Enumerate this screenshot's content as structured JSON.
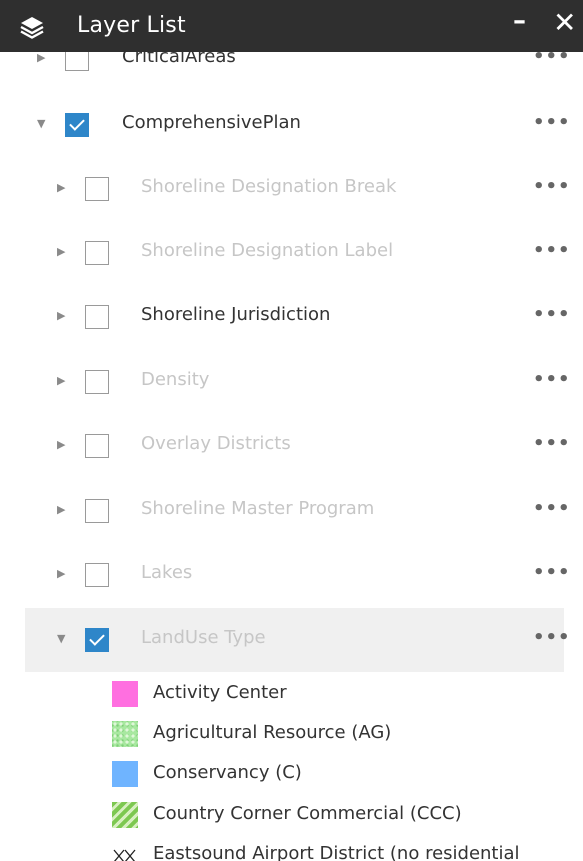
{
  "header": {
    "title": "Layer List",
    "minimize_glyph": "–",
    "close_glyph": "✕",
    "icon": "layers-icon"
  },
  "layers": [
    {
      "label": "CriticalAreas",
      "checked": false,
      "expanded": false,
      "dim": false,
      "level": 0
    },
    {
      "label": "ComprehensivePlan",
      "checked": true,
      "expanded": true,
      "dim": false,
      "level": 0
    },
    {
      "label": "Shoreline Designation Break",
      "checked": false,
      "expanded": false,
      "dim": true,
      "level": 1
    },
    {
      "label": "Shoreline Designation Label",
      "checked": false,
      "expanded": false,
      "dim": true,
      "level": 1
    },
    {
      "label": "Shoreline Jurisdiction",
      "checked": false,
      "expanded": false,
      "dim": false,
      "level": 1
    },
    {
      "label": "Density",
      "checked": false,
      "expanded": false,
      "dim": true,
      "level": 1
    },
    {
      "label": "Overlay Districts",
      "checked": false,
      "expanded": false,
      "dim": true,
      "level": 1
    },
    {
      "label": "Shoreline Master Program",
      "checked": false,
      "expanded": false,
      "dim": true,
      "level": 1
    },
    {
      "label": "Lakes",
      "checked": false,
      "expanded": false,
      "dim": true,
      "level": 1
    },
    {
      "label": "LandUse Type",
      "checked": true,
      "expanded": true,
      "dim": true,
      "level": 1,
      "selected": true
    }
  ],
  "options_glyph": "•••",
  "legend": [
    {
      "label": "Activity Center",
      "swatch": "solid",
      "color": "#ff6fe0"
    },
    {
      "label": "Agricultural Resource (AG)",
      "swatch": "speckle",
      "color": "#a8e8a0"
    },
    {
      "label": "Conservancy (C)",
      "swatch": "solid",
      "color": "#6fb4ff"
    },
    {
      "label": "Country Corner Commercial (CCC)",
      "swatch": "hatch",
      "color": "#7dc850"
    },
    {
      "label": "Eastsound Airport District (no residential",
      "swatch": "cross",
      "color": "#222222"
    }
  ],
  "colors": {
    "titlebar": "#2f2f2f",
    "checkbox_on": "#2e86c9",
    "dim_text": "#c6c6c6"
  }
}
